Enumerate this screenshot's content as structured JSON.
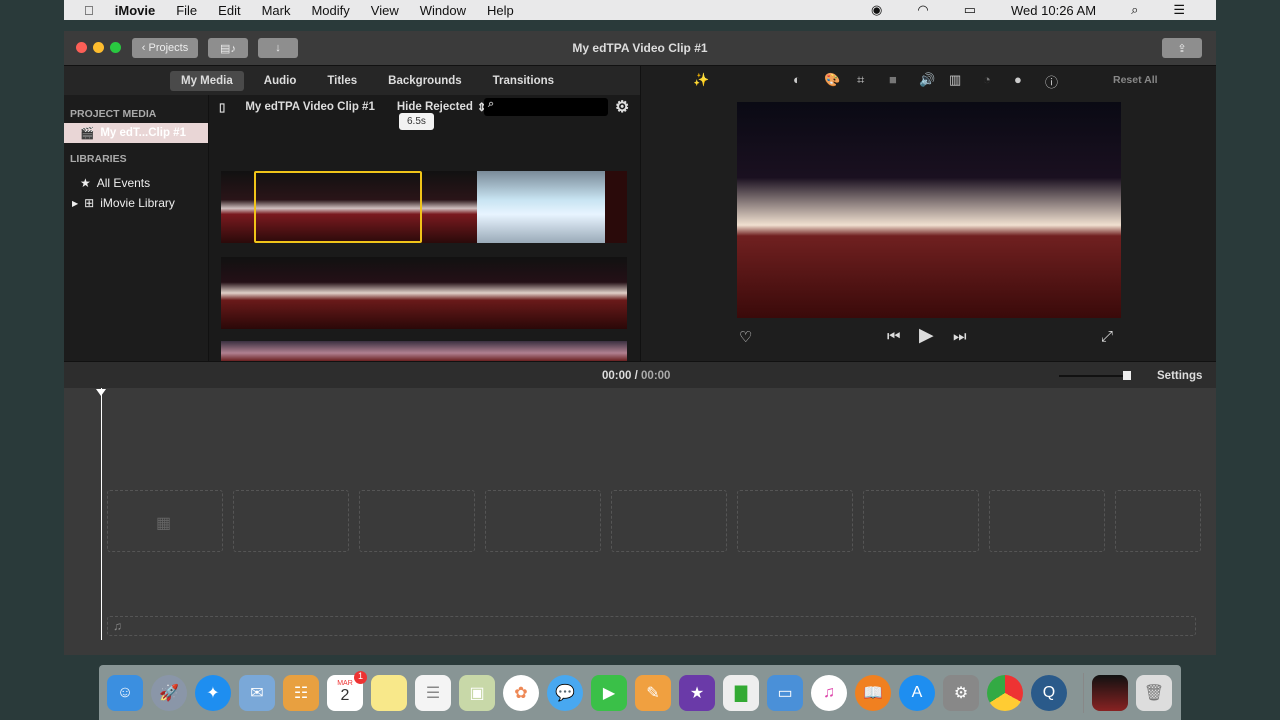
{
  "menubar": {
    "apple": "",
    "app": "iMovie",
    "items": [
      "File",
      "Edit",
      "Mark",
      "Modify",
      "View",
      "Window",
      "Help"
    ],
    "clock": "Wed 10:26 AM"
  },
  "window": {
    "title": "My edTPA Video Clip #1",
    "projects_button": "Projects"
  },
  "tabs": [
    "My Media",
    "Audio",
    "Titles",
    "Backgrounds",
    "Transitions"
  ],
  "sidebar": {
    "project_media_header": "PROJECT MEDIA",
    "project_item": "My edT...Clip #1",
    "libraries_header": "LIBRARIES",
    "libraries": [
      "All Events",
      "iMovie Library"
    ]
  },
  "browser": {
    "title": "My edTPA Video Clip #1",
    "filter": "Hide Rejected",
    "search_placeholder": "",
    "tooltip": "6.5s"
  },
  "viewer": {
    "reset_all": "Reset All",
    "tools": [
      "magic-wand",
      "color-balance",
      "color-correction",
      "crop",
      "stabilization",
      "volume",
      "noise-reduction",
      "speed",
      "filter",
      "info"
    ]
  },
  "timeline": {
    "current": "00:00",
    "separator": "/",
    "total": "00:00",
    "settings": "Settings",
    "zoom_level": 0.9
  },
  "dock": {
    "apps": [
      "Finder",
      "Launchpad",
      "Safari",
      "Mail",
      "Contacts",
      "Calendar",
      "Notes",
      "Reminders",
      "Preview",
      "Photos",
      "Messages",
      "FaceTime",
      "Pages",
      "iMovie",
      "Numbers",
      "Keynote",
      "iTunes",
      "iBooks",
      "App Store",
      "System Preferences",
      "Chrome",
      "QuickTime"
    ],
    "calendar_month": "MAR",
    "calendar_day": "2",
    "calendar_badge": "1"
  },
  "colors": {
    "selection": "#f0c419",
    "accent": "#e9d6d6"
  }
}
